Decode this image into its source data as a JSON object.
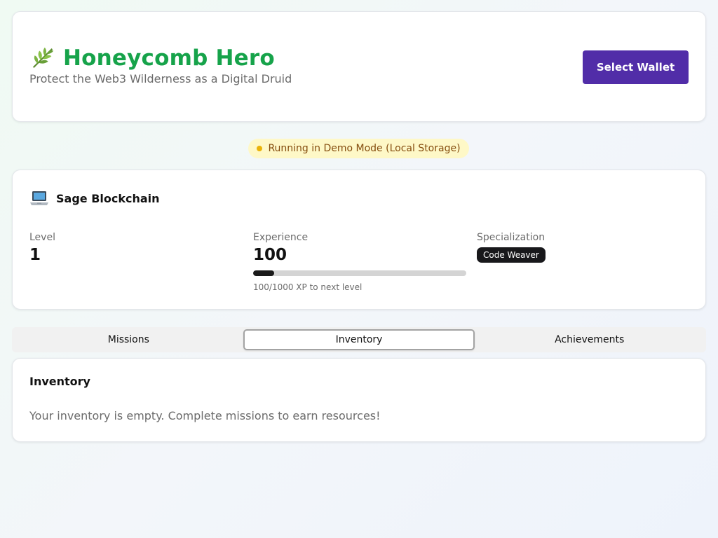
{
  "header": {
    "title": "Honeycomb Hero",
    "subtitle": "Protect the Web3 Wilderness as a Digital Druid",
    "title_icon": "leaf-icon",
    "wallet_button": "Select Wallet"
  },
  "colors": {
    "brand_green": "#16a34a",
    "wallet_purple": "#512da8",
    "demo_badge_bg": "#fef8c7",
    "demo_dot": "#eab308"
  },
  "demo_badge": {
    "text": "Running in Demo Mode (Local Storage)"
  },
  "profile": {
    "icon": "laptop-icon",
    "name": "Sage Blockchain",
    "level_label": "Level",
    "level_value": "1",
    "xp_label": "Experience",
    "xp_value": "100",
    "xp_progress_fraction": 0.1,
    "xp_caption": "100/1000 XP to next level",
    "spec_label": "Specialization",
    "spec_value": "Code Weaver"
  },
  "tabs": [
    {
      "label": "Missions"
    },
    {
      "label": "Inventory",
      "active": true
    },
    {
      "label": "Achievements"
    }
  ],
  "inventory": {
    "title": "Inventory",
    "empty_message": "Your inventory is empty. Complete missions to earn resources!"
  }
}
